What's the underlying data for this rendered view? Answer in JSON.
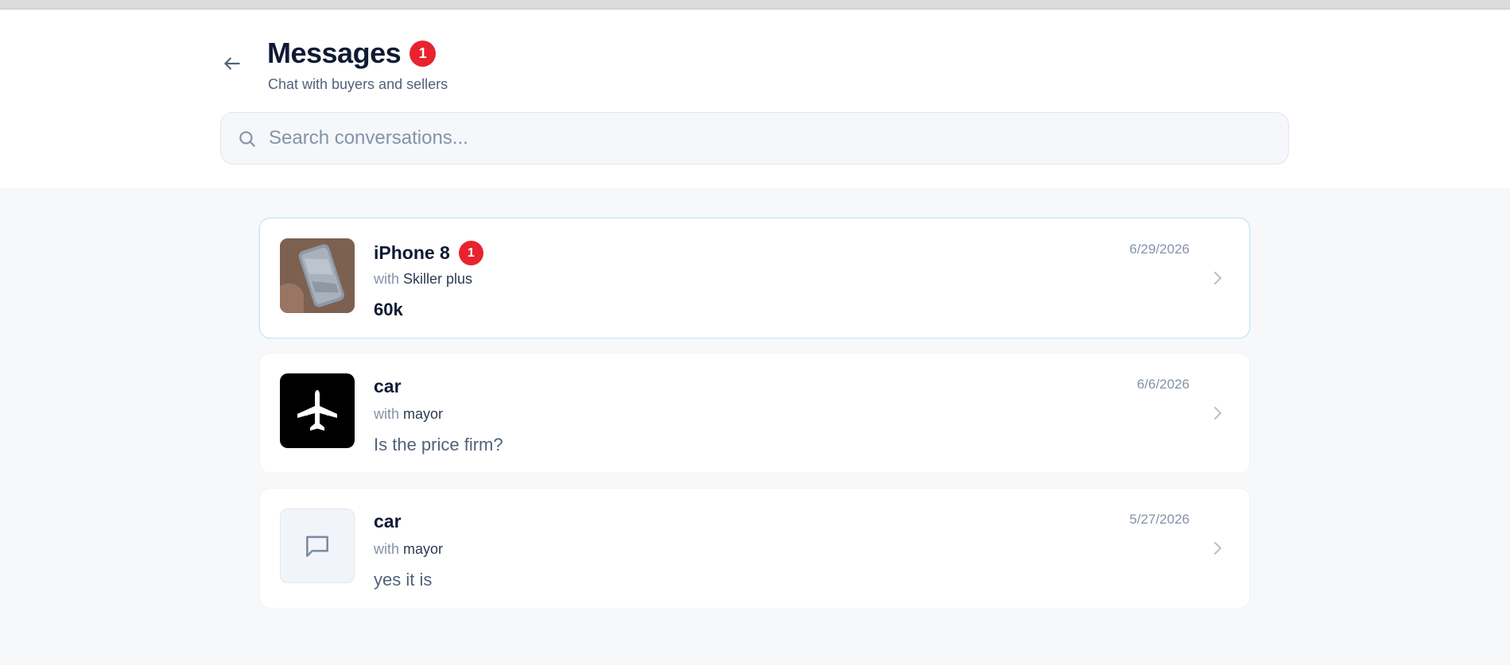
{
  "header": {
    "title": "Messages",
    "unread_count": "1",
    "subtitle": "Chat with buyers and sellers"
  },
  "search": {
    "placeholder": "Search conversations...",
    "value": ""
  },
  "colors": {
    "badge": "#e8232f",
    "title": "#0f1a33",
    "muted": "#8592a8",
    "unread_border": "#bfe8f6",
    "page_bg": "#f7f8fa"
  },
  "conversations": [
    {
      "title": "iPhone 8",
      "unread_count": "1",
      "with_word": "with",
      "with_name": "Skiller plus",
      "last_message": "60k",
      "date": "6/29/2026",
      "thumbnail": "phone-photo",
      "unread": true
    },
    {
      "title": "car",
      "unread_count": "",
      "with_word": "with",
      "with_name": "mayor",
      "last_message": "Is the price firm?",
      "date": "6/6/2026",
      "thumbnail": "airplane-icon",
      "unread": false
    },
    {
      "title": "car",
      "unread_count": "",
      "with_word": "with",
      "with_name": "mayor",
      "last_message": "yes it is",
      "date": "5/27/2026",
      "thumbnail": "chat-bubble-icon",
      "unread": false
    }
  ]
}
